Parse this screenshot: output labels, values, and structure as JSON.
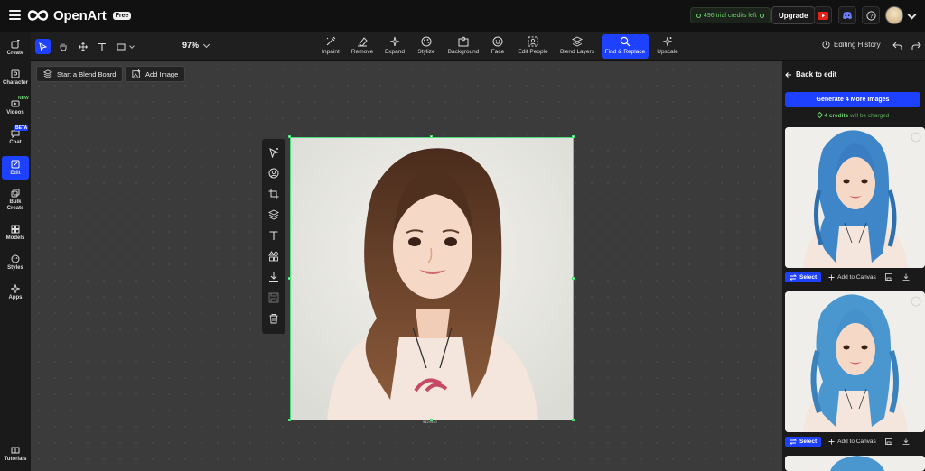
{
  "app": {
    "name": "OpenArt",
    "plan_badge": "Free",
    "credits_text": "496 trial credits left",
    "upgrade_label": "Upgrade"
  },
  "leftnav": {
    "items": [
      {
        "label": "Create",
        "icon": "create-icon"
      },
      {
        "label": "Character",
        "icon": "character-icon"
      },
      {
        "label": "Videos",
        "icon": "videos-icon",
        "badge": "NEW"
      },
      {
        "label": "Chat",
        "icon": "chat-icon",
        "badge": "BETA"
      },
      {
        "label": "Edit",
        "icon": "edit-icon",
        "active": true
      },
      {
        "label": "Bulk Create",
        "icon": "bulk-create-icon"
      },
      {
        "label": "Models",
        "icon": "models-icon"
      },
      {
        "label": "Styles",
        "icon": "styles-icon"
      },
      {
        "label": "Apps",
        "icon": "apps-icon"
      }
    ],
    "tutorials_label": "Tutorials"
  },
  "toolbar": {
    "zoom": "97%",
    "tools": [
      {
        "label": "Inpaint",
        "icon": "inpaint-icon"
      },
      {
        "label": "Remove",
        "icon": "remove-icon"
      },
      {
        "label": "Expand",
        "icon": "expand-icon"
      },
      {
        "label": "Stylize",
        "icon": "stylize-icon"
      },
      {
        "label": "Background",
        "icon": "background-icon"
      },
      {
        "label": "Face",
        "icon": "face-icon"
      },
      {
        "label": "Edit People",
        "icon": "edit-people-icon"
      },
      {
        "label": "Blend Layers",
        "icon": "blend-layers-icon"
      },
      {
        "label": "Find & Replace",
        "icon": "find-replace-icon",
        "active": true
      },
      {
        "label": "Upscale",
        "icon": "upscale-icon"
      }
    ],
    "history_label": "Editing History"
  },
  "canvas": {
    "blend_board_label": "Start a Blend Board",
    "add_image_label": "Add Image",
    "image_dimensions": "942×940"
  },
  "panel": {
    "back_label": "Back to edit",
    "generate_label": "Generate 4 More Images",
    "charge_amount": "4 credits",
    "charge_suffix": "will be charged",
    "select_label": "Select",
    "add_to_canvas_label": "Add to Canvas"
  },
  "colors": {
    "accent": "#1e40ff",
    "credit_green": "#6ed36e",
    "selection_green": "#49e07a"
  }
}
